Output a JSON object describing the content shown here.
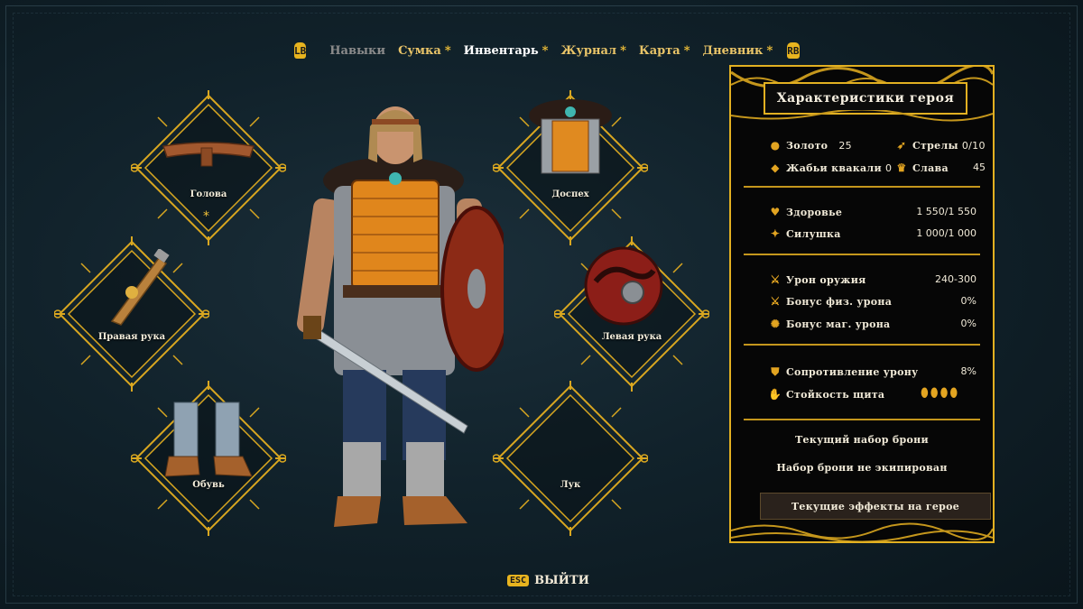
{
  "nav": {
    "left_bumper": "LB",
    "right_bumper": "RB",
    "tabs": [
      {
        "label": "Навыки",
        "star": "",
        "color": "#8b8b8b"
      },
      {
        "label": "Сумка",
        "star": "*",
        "color": "#e9c468"
      },
      {
        "label": "Инвентарь",
        "star": "*",
        "color": "#ffffff"
      },
      {
        "label": "Журнал",
        "star": "*",
        "color": "#e9c468"
      },
      {
        "label": "Карта",
        "star": "*",
        "color": "#e9c468"
      },
      {
        "label": "Дневник",
        "star": "*",
        "color": "#e9c468"
      }
    ]
  },
  "slots": {
    "head": {
      "label": "Голова",
      "star": "*"
    },
    "armor": {
      "label": "Доспех"
    },
    "right_hand": {
      "label": "Правая рука"
    },
    "left_hand": {
      "label": "Левая рука"
    },
    "boots": {
      "label": "Обувь"
    },
    "bow": {
      "label": "Лук"
    }
  },
  "panel": {
    "title": "Характеристики героя",
    "gold_label": "Золото",
    "gold_value": "25",
    "arrows_label": "Стрелы",
    "arrows_value": "0/10",
    "frogs_label": "Жабьи квакали",
    "frogs_value": "0",
    "glory_label": "Слава",
    "glory_value": "45",
    "health_label": "Здоровье",
    "health_value": "1 550/1 550",
    "strength_label": "Силушка",
    "strength_value": "1 000/1 000",
    "weapon_dmg_label": "Урон оружия",
    "weapon_dmg_value": "240-300",
    "phys_bonus_label": "Бонус физ. урона",
    "phys_bonus_value": "0%",
    "mag_bonus_label": "Бонус маг. урона",
    "mag_bonus_value": "0%",
    "dmg_resist_label": "Сопротивление урону",
    "dmg_resist_value": "8%",
    "shield_label": "Стойкость щита",
    "armor_set_label": "Текущий набор брони",
    "armor_set_status": "Набор брони не экипирован",
    "effects_button": "Текущие эффекты на герое"
  },
  "exit": {
    "key": "ESC",
    "label": "ВЫЙТИ"
  },
  "colors": {
    "accent": "#e2b021",
    "panel_bg": "#060606",
    "background": "#11222b"
  }
}
